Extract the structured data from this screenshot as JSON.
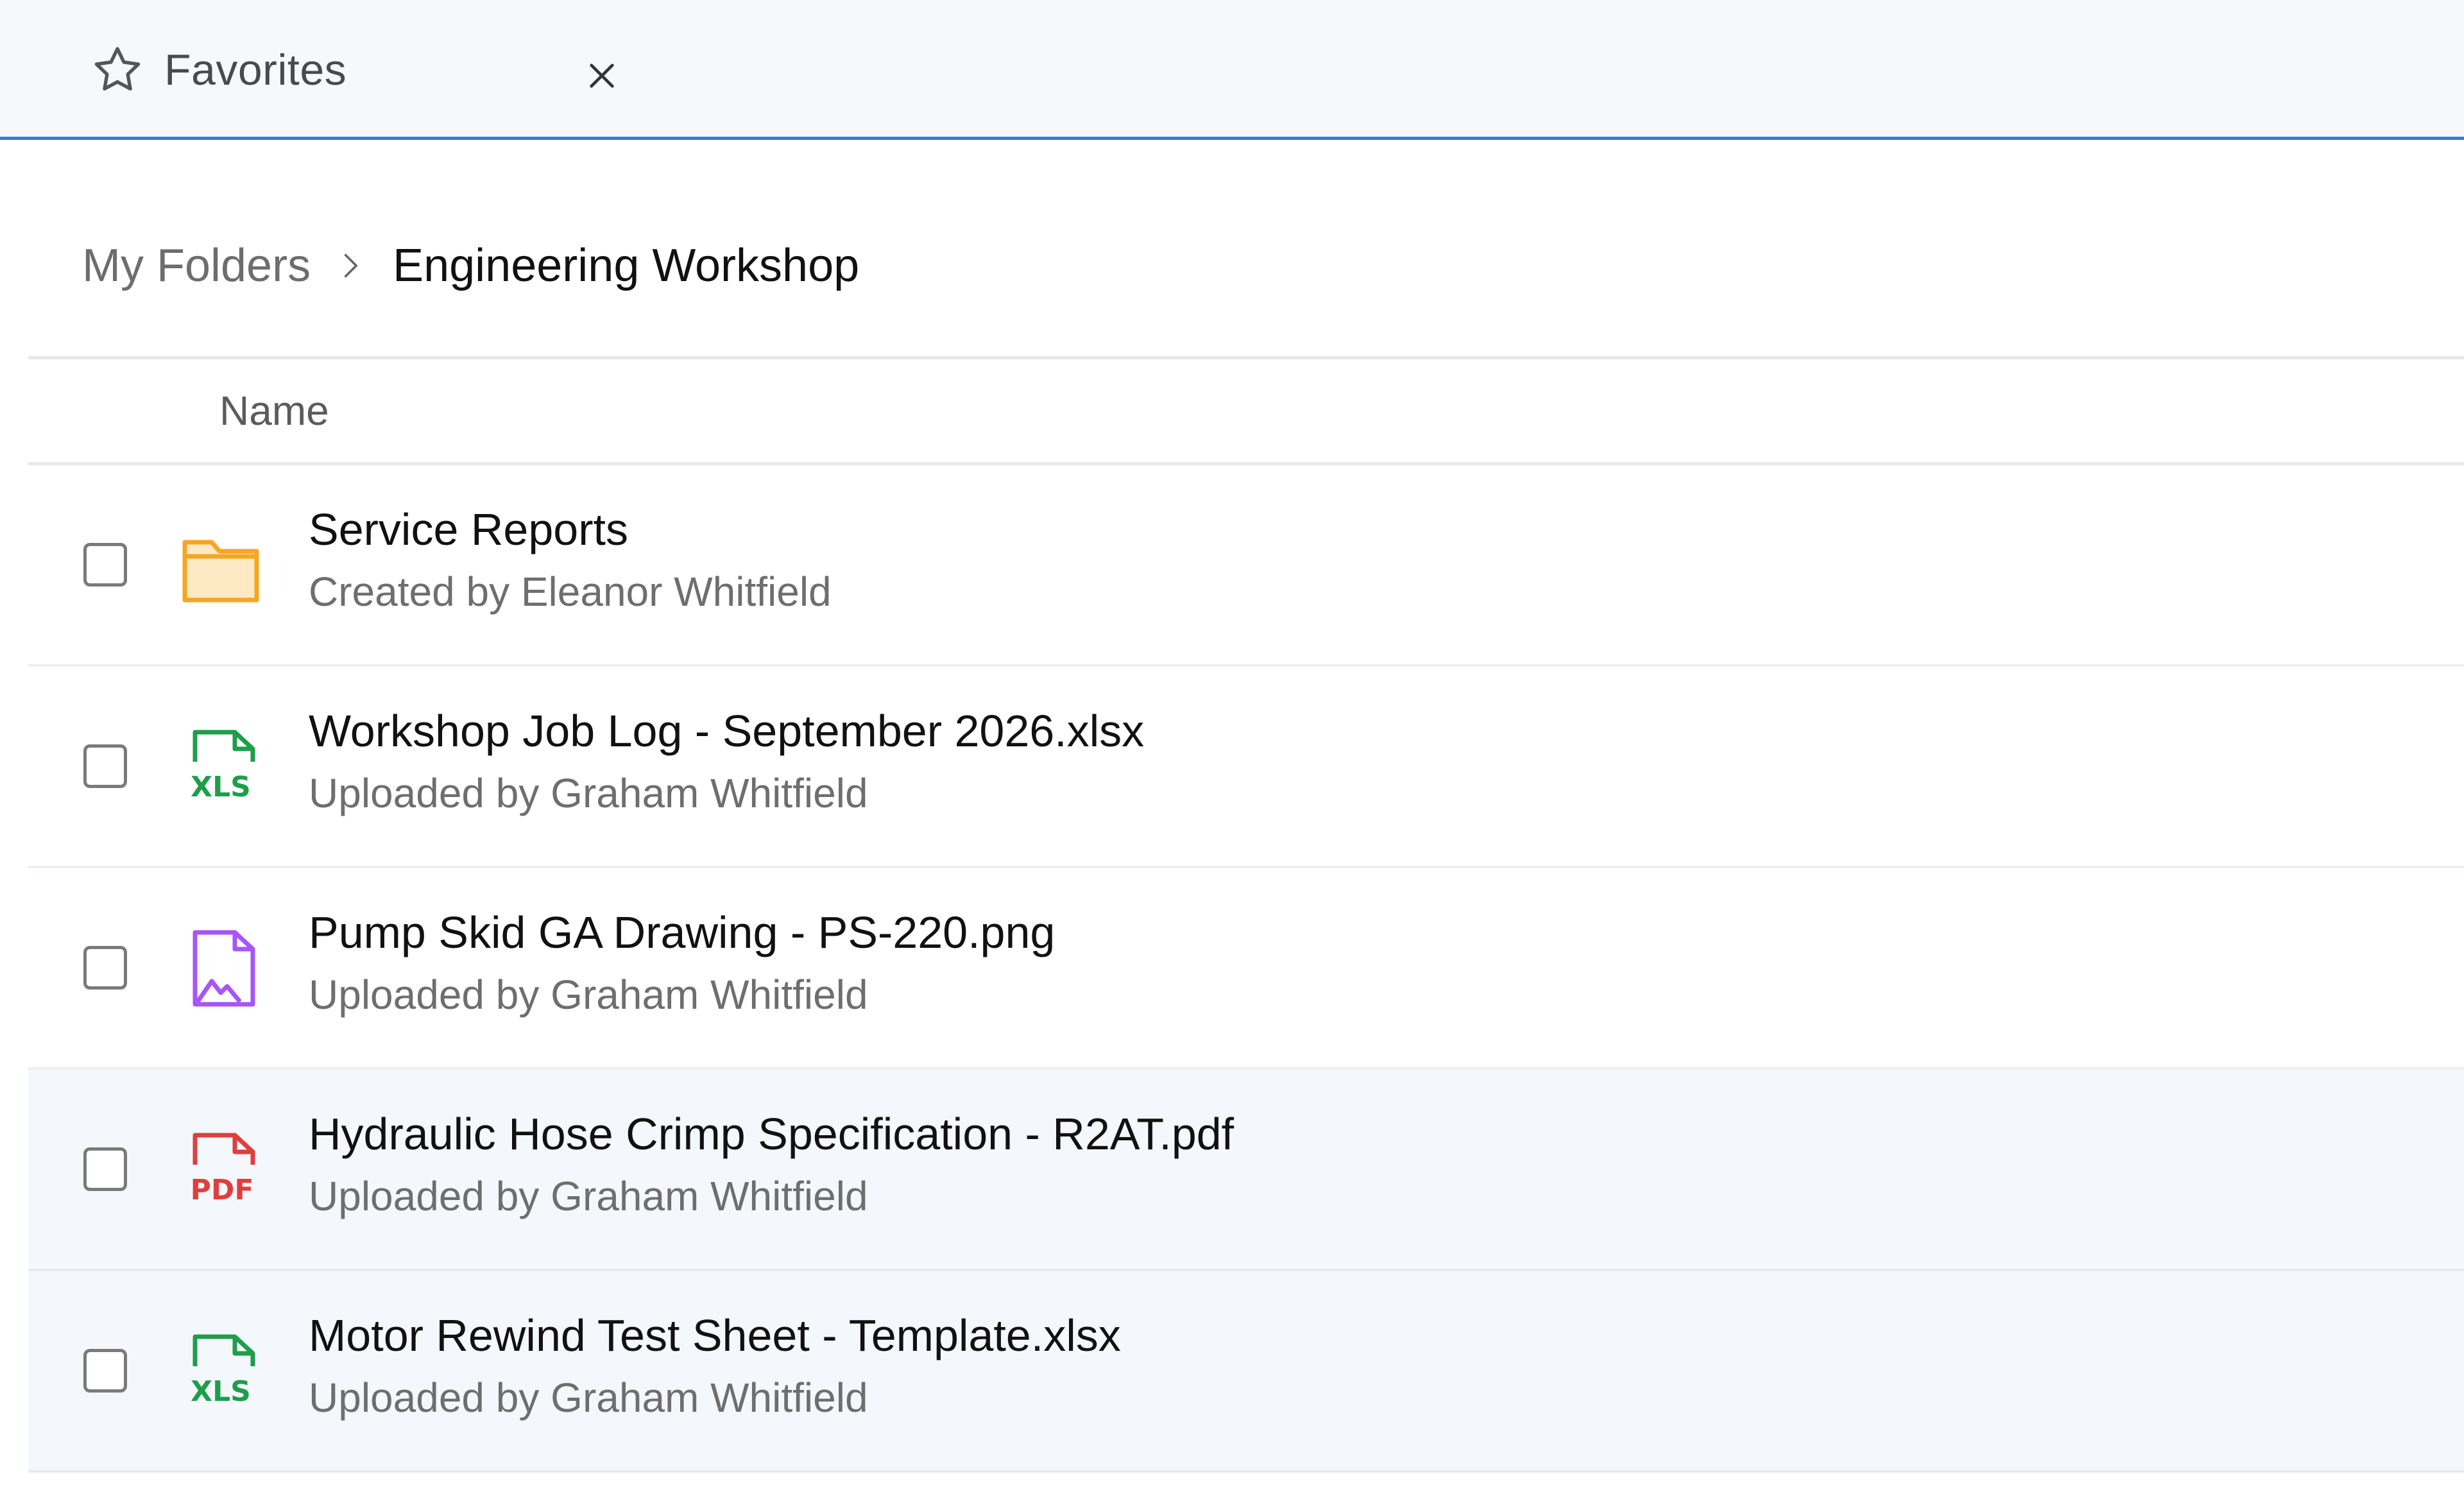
{
  "tab": {
    "label": "Favorites",
    "icon": "star-icon",
    "close_icon": "close-icon"
  },
  "breadcrumb": {
    "parent": "My Folders",
    "separator_icon": "chevron-right-icon",
    "current": "Engineering Workshop"
  },
  "table": {
    "column_name": "Name"
  },
  "files": [
    {
      "name": "Service Reports",
      "meta": "Created by Eleanor Whitfield",
      "icon": "folder-icon"
    },
    {
      "name": "Workshop Job Log - September 2026.xlsx",
      "meta": "Uploaded by Graham Whitfield",
      "icon": "xls-file-icon"
    },
    {
      "name": "Pump Skid GA Drawing - PS-220.png",
      "meta": "Uploaded by Graham Whitfield",
      "icon": "image-file-icon"
    },
    {
      "name": "Hydraulic Hose Crimp Specification - R2AT.pdf",
      "meta": "Uploaded by Graham Whitfield",
      "icon": "pdf-file-icon"
    },
    {
      "name": "Motor Rewind Test Sheet - Template.xlsx",
      "meta": "Uploaded by Graham Whitfield",
      "icon": "xls-file-icon"
    }
  ],
  "colors": {
    "accent": "#3b78d8",
    "folder": "#f5a623",
    "xls": "#1e9e4a",
    "image": "#a855f7",
    "pdf": "#e03e3e",
    "row_highlight": "#f4f7fb"
  }
}
